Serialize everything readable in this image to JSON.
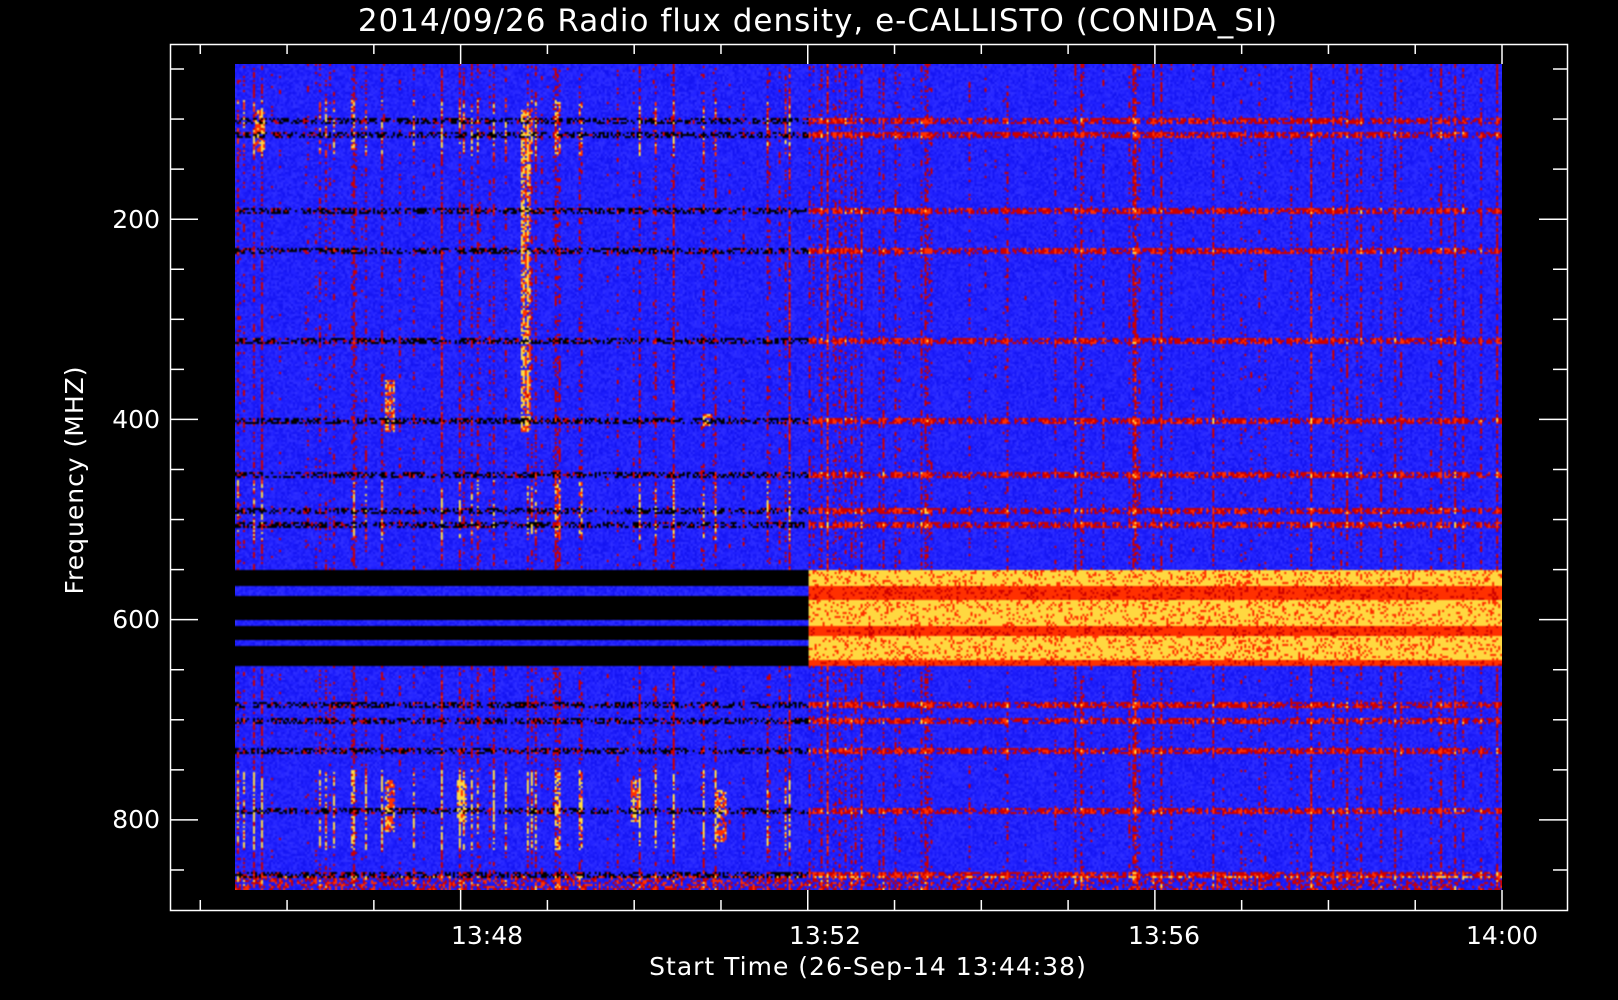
{
  "chart_data": {
    "type": "heatmap",
    "title": "2014/09/26  Radio flux density, e-CALLISTO (CONIDA_SI)",
    "xlabel": "Start Time (26-Sep-14 13:44:38)",
    "ylabel": "Frequency (MHZ)",
    "y_ticks": [
      200,
      400,
      600,
      800
    ],
    "y_tick_labels": [
      "200",
      "400",
      "600",
      "800"
    ],
    "x_ticks": [
      "13:48",
      "13:52",
      "13:56",
      "14:00"
    ],
    "x_tick_labels": [
      "13:48",
      "13:52",
      "13:56",
      "14:00"
    ],
    "xlim": [
      "13:44:38",
      "14:01:38"
    ],
    "data_xlim": [
      "13:45:24",
      "14:00:00"
    ],
    "ylim": [
      885,
      0
    ],
    "data_ylim": [
      45,
      870
    ],
    "colormap": [
      "#000000",
      "#1e1eff",
      "#cc0000",
      "#ff3000",
      "#ffd840"
    ],
    "background_color": "#2222ff",
    "regime_change_time": "13:52:00",
    "dark_band_before": [
      [
        550,
        645
      ]
    ],
    "bright_band_after": [
      [
        550,
        645
      ]
    ],
    "bursts_before_change": [
      {
        "time": "13:45:40",
        "freq": [
          90,
          130
        ]
      },
      {
        "time": "13:47:10",
        "freq": [
          360,
          410
        ]
      },
      {
        "time": "13:48:45",
        "freq": [
          90,
          410
        ]
      },
      {
        "time": "13:50:50",
        "freq": [
          395,
          405
        ]
      },
      {
        "time": "13:47:10",
        "freq": [
          760,
          810
        ]
      },
      {
        "time": "13:48:00",
        "freq": [
          760,
          800
        ]
      },
      {
        "time": "13:50:00",
        "freq": [
          760,
          800
        ]
      },
      {
        "time": "13:51:00",
        "freq": [
          770,
          820
        ]
      }
    ],
    "horizontal_lines": [
      100,
      115,
      190,
      230,
      320,
      400,
      455,
      490,
      505,
      685,
      700,
      730,
      790,
      855
    ]
  }
}
